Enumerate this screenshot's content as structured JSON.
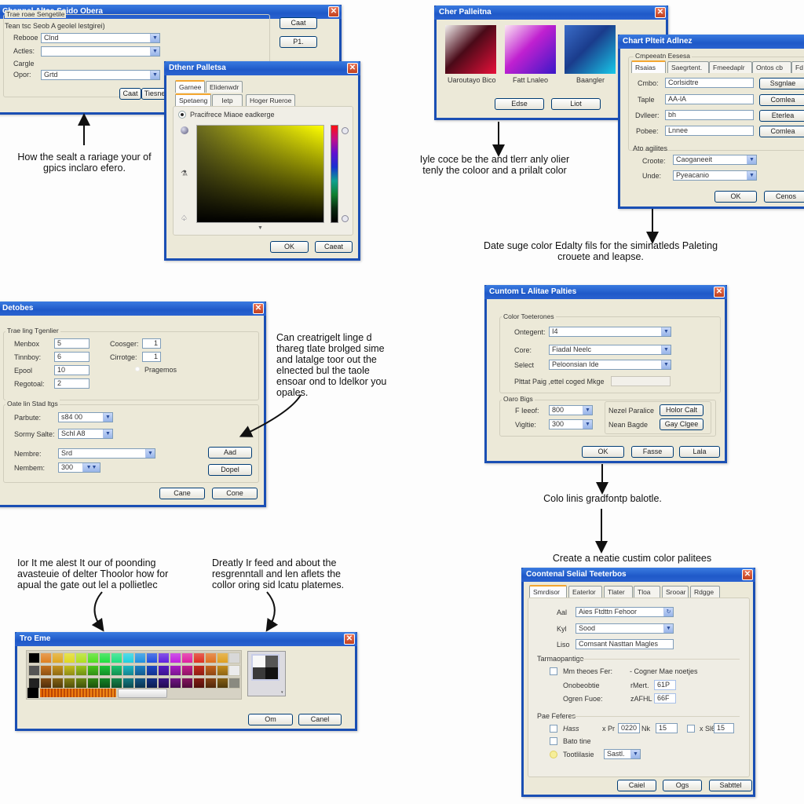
{
  "dialog_a": {
    "title": "Channel Altca Saido Obera",
    "group_label": "Trae roae Sengetile",
    "subheading": "Tean tsc Seob A geolel lestgirei)",
    "fields": [
      {
        "label": "Rebooe",
        "value": "Clnd"
      },
      {
        "label": "Actles:",
        "value": ""
      },
      {
        "label": "Opor:",
        "value": "Grtd"
      }
    ],
    "label_extra": "Cargle",
    "side_buttons": [
      "Caat",
      "P1."
    ],
    "bottom_buttons": [
      "Caat",
      "Tiesne"
    ]
  },
  "dialog_b": {
    "title": "Dthenr Palletsa",
    "tabs_row1": [
      "Garnee",
      "Elidenwdr"
    ],
    "tabs_row2": [
      "Spetaeng",
      "Ietp",
      "Hoger Rueroe"
    ],
    "radio_label": "Pracifrece Miaoe eadkerge",
    "buttons": [
      "OK",
      "Caeat"
    ]
  },
  "dialog_c": {
    "title": "Cher Palleitna",
    "swatches": [
      {
        "label": "Uaroutayo Bico",
        "colors": [
          "#f4f0f0",
          "#4a0a18",
          "#e8103a"
        ]
      },
      {
        "label": "Fatt Lnaleo",
        "colors": [
          "#fbe4f4",
          "#c020d0",
          "#3a18c8"
        ]
      },
      {
        "label": "Baangler",
        "colors": [
          "#3a6cc8",
          "#1a3c8c",
          "#18c8e8"
        ]
      }
    ],
    "buttons": [
      "Edse",
      "Liot"
    ]
  },
  "dialog_d": {
    "title": "Chart Plteit Adlnez",
    "group_label": "Cmpeeatn Eesesa",
    "tabs": [
      "Rsaias",
      "Saegrtent.",
      "Fmeedaplr",
      "Ontos cb",
      "Fd"
    ],
    "rows": [
      {
        "label": "Cmbo:",
        "value": "Corlsidtre",
        "button": "Ssgnlae"
      },
      {
        "label": "Taple",
        "value": "AA-lA",
        "button": "Comlea"
      },
      {
        "label": "Dvlleer:",
        "value": "bh",
        "button": "Eterlea"
      },
      {
        "label": "Pobee:",
        "value": "Lnnee",
        "button": "Comlea"
      }
    ],
    "group2_label": "Ato agilites",
    "selects": [
      {
        "label": "Croote:",
        "value": "Caoganeeit"
      },
      {
        "label": "Unde:",
        "value": "Pyeacanio"
      }
    ],
    "buttons": [
      "OK",
      "Cenos"
    ]
  },
  "dialog_e": {
    "title": "Detobes",
    "group1_label": "Trae ling Tgenlier",
    "left_fields": [
      {
        "label": "Menbox",
        "value": "5"
      },
      {
        "label": "Tinnboy:",
        "value": "6"
      },
      {
        "label": "Epool",
        "value": "10"
      },
      {
        "label": "Regotoal:",
        "value": "2"
      }
    ],
    "right_fields": [
      {
        "label": "Coosger:",
        "value": "1"
      },
      {
        "label": "Cirrotge:",
        "value": "1"
      }
    ],
    "radio_label": "Pragemos",
    "group2_label": "Oate lin Stad ltgs",
    "selects": [
      {
        "label": "Parbute:",
        "value": "s84 00"
      },
      {
        "label": "Sormy Salte:",
        "value": "Schl A8"
      },
      {
        "label": "Nembre:",
        "value": "Srd"
      },
      {
        "label": "Nembem:",
        "value": "300"
      }
    ],
    "side_buttons": [
      "Aad",
      "Dopel"
    ],
    "bottom_buttons": [
      "Cane",
      "Cone"
    ]
  },
  "dialog_f": {
    "title": "Cuntom L Alitae Palties",
    "group1_label": "Color Toeterones",
    "selects": [
      {
        "label": "Ontegent:",
        "value": "I4"
      },
      {
        "label": "Core:",
        "value": "Fiadal Neelc"
      },
      {
        "label": "Select",
        "value": "Peloonsian Ide"
      }
    ],
    "text_row_label": "Plttat Paig ,ettel coged Mkge",
    "group2_label": "Oaro Bigs",
    "small_selects": [
      {
        "label": "F Ieeof:",
        "value": "800"
      },
      {
        "label": "Vigltie:",
        "value": "300"
      }
    ],
    "right_pairs": [
      {
        "label": "Nezel Paralice",
        "value": "Holor Calt"
      },
      {
        "label": "Nean Bagde",
        "value": "Gay Clgee"
      }
    ],
    "buttons": [
      "OK",
      "Fasse",
      "Lala"
    ]
  },
  "dialog_g": {
    "title": "Tro Eme",
    "buttons": [
      "Om",
      "Canel"
    ]
  },
  "dialog_h": {
    "title": "Coontenal Selial Teeterbos",
    "tabs": [
      "Smrdisor",
      "Eaterlor",
      "Tlater",
      "Tloa",
      "Srooar",
      "Rdgge"
    ],
    "rows": [
      {
        "label": "Aal",
        "value": "Aies Ftdttn Fehoor"
      },
      {
        "label": "Kyl",
        "value": "Sood"
      },
      {
        "label": "Liso",
        "value": "Comsant Nasttan Magles"
      }
    ],
    "group1_label": "Tarmaopantige",
    "t_rows": [
      {
        "label": "Mm theoes Fer:",
        "mid": "- Cogner Mae noetjes",
        "value": ""
      },
      {
        "label": "Onobeobtie",
        "mid": "rMert.",
        "value": "61P"
      },
      {
        "label": "Ogren Fuoe:",
        "mid": "zAFHL",
        "value": "66F"
      }
    ],
    "group2_label": "Pae Feferes",
    "p_rows": [
      {
        "label": "Hass",
        "mid": "x Pr",
        "value": "0220",
        "unit": "Nk",
        "value2": "15",
        "extra_label": "x Sl6",
        "extra_value": "15"
      },
      {
        "label": "Bato tine"
      },
      {
        "label": "Tootlilasie",
        "value": "Sastl."
      }
    ],
    "buttons": [
      "Caiel",
      "Ogs",
      "Sabttel"
    ]
  },
  "captions": {
    "c1": "How the sealt a rariage your of gpics inclaro efero.",
    "c2": "Iyle coce be the and tlerr anly olier tenly the coloor and a prilalt color",
    "c3": "Date suge color Edalty fils for the siminatleds Paleting crouete and leapse.",
    "c4": "Can creatrigelt linge d thareg tlate brolged sime and latalge toor out the elnected bul the taole ensoar ond to ldelkor you opales.",
    "c5": "Colo linis gradfontp balotle.",
    "c6": "Create a neatie custim color palitees",
    "c7": "Ior It me alest It our of poonding avasteuie of delter Thoolor how for apual the gate out lel a pollietlec",
    "c8": "Dreatly Ir feed and about the resgrenntall and len aflets the collor oring sid lcatu platemes."
  },
  "colors": {
    "titlebar": "#1f59c8",
    "dialog_bg": "#ece9d8",
    "close": "#c2401e"
  }
}
